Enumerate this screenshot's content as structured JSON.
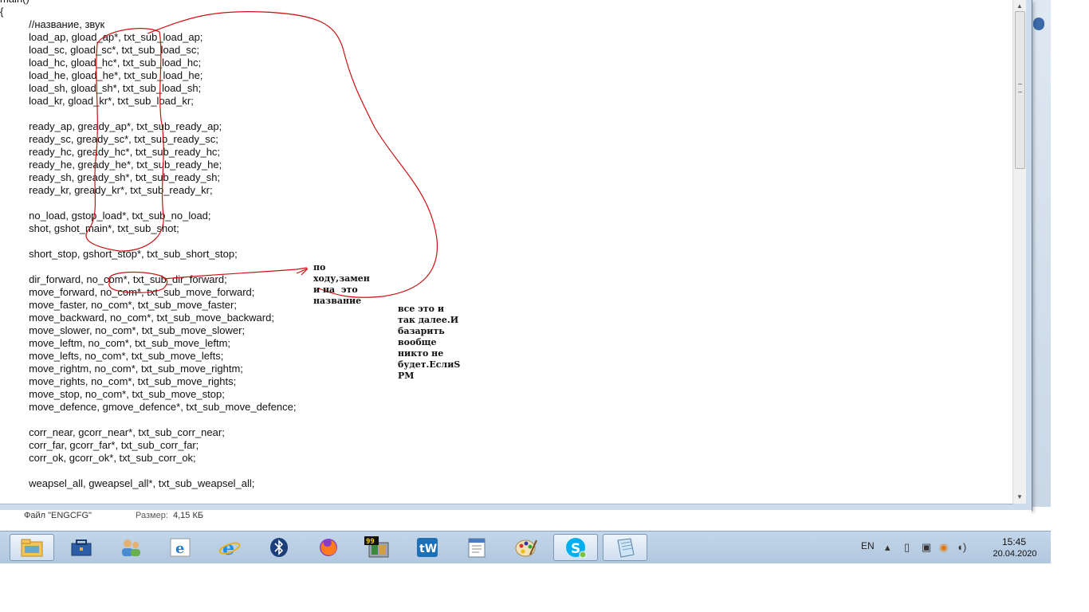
{
  "editor": {
    "lines": [
      "main()",
      "{",
      "          //название, звук",
      "          load_ap, gload_ap*, txt_sub_load_ap;",
      "          load_sc, gload_sc*, txt_sub_load_sc;",
      "          load_hc, gload_hc*, txt_sub_load_hc;",
      "          load_he, gload_he*, txt_sub_load_he;",
      "          load_sh, gload_sh*, txt_sub_load_sh;",
      "          load_kr, gload_kr*, txt_sub_load_kr;",
      "",
      "          ready_ap, gready_ap*, txt_sub_ready_ap;",
      "          ready_sc, gready_sc*, txt_sub_ready_sc;",
      "          ready_hc, gready_hc*, txt_sub_ready_hc;",
      "          ready_he, gready_he*, txt_sub_ready_he;",
      "          ready_sh, gready_sh*, txt_sub_ready_sh;",
      "          ready_kr, gready_kr*, txt_sub_ready_kr;",
      "",
      "          no_load, gstop_load*, txt_sub_no_load;",
      "          shot, gshot_main*, txt_sub_shot;",
      "",
      "          short_stop, gshort_stop*, txt_sub_short_stop;",
      "",
      "          dir_forward, no_com*, txt_sub_dir_forward;",
      "          move_forward, no_com*, txt_sub_move_forward;",
      "          move_faster, no_com*, txt_sub_move_faster;",
      "          move_backward, no_com*, txt_sub_move_backward;",
      "          move_slower, no_com*, txt_sub_move_slower;",
      "          move_leftm, no_com*, txt_sub_move_leftm;",
      "          move_lefts, no_com*, txt_sub_move_lefts;",
      "          move_rightm, no_com*, txt_sub_move_rightm;",
      "          move_rights, no_com*, txt_sub_move_rights;",
      "          move_stop, no_com*, txt_sub_move_stop;",
      "          move_defence, gmove_defence*, txt_sub_move_defence;",
      "",
      "          corr_near, gcorr_near*, txt_sub_corr_near;",
      "          corr_far, gcorr_far*, txt_sub_corr_far;",
      "          corr_ok, gcorr_ok*, txt_sub_corr_ok;",
      "",
      "          weapsel_all, gweapsel_all*, txt_sub_weapsel_all;"
    ]
  },
  "annotations": {
    "note1": "по\nходу,замен\nи на  это\nназвание",
    "note2": "все это и\nтак далее.И\nбазарить\nвообще\nникто не\nбудет.ЕслиS\nPM"
  },
  "status": {
    "file": "Файл \"ENGCFG\"",
    "size_label": "Размер:",
    "size_value": "4,15 КБ"
  },
  "taskbar": {
    "lang": "EN",
    "time": "15:45",
    "date": "20.04.2020",
    "apps": [
      {
        "icon": "file-explorer-icon"
      },
      {
        "icon": "toolbox-icon"
      },
      {
        "icon": "users-icon"
      },
      {
        "icon": "internet-explorer-icon"
      },
      {
        "icon": "internet-explorer-alt-icon"
      },
      {
        "icon": "bluetooth-icon"
      },
      {
        "icon": "firefox-icon"
      },
      {
        "icon": "app-99-icon"
      },
      {
        "icon": "tw-icon"
      },
      {
        "icon": "wordpad-icon"
      },
      {
        "icon": "paint-icon"
      },
      {
        "icon": "skype-icon"
      },
      {
        "icon": "notepad-icon"
      }
    ],
    "apps_badge_text": "99",
    "apps_tw_text": "tW"
  },
  "colors": {
    "annotation_ink": "#cc0000",
    "taskbar": "#b9cde3"
  }
}
